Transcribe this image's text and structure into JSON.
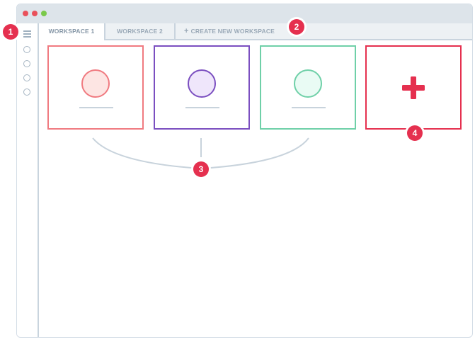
{
  "tabs": [
    {
      "label": "WORKSPACE 1"
    },
    {
      "label": "WORKSPACE 2"
    },
    {
      "label": "CREATE NEW WORKSPACE",
      "icon": "plus-icon"
    }
  ],
  "badges": [
    "1",
    "2",
    "3",
    "4"
  ],
  "colors": {
    "card1_border": "#f07a80",
    "card1_fill": "#fde5e3",
    "card2_border": "#7b4fc0",
    "card2_fill": "#efe6fb",
    "card3_border": "#6fd0a8",
    "card3_fill": "#e9fbf4",
    "card4_border": "#e5304f",
    "badge": "#e5304f"
  },
  "icons": {
    "hamburger": "hamburger-icon",
    "add": "plus-icon"
  }
}
